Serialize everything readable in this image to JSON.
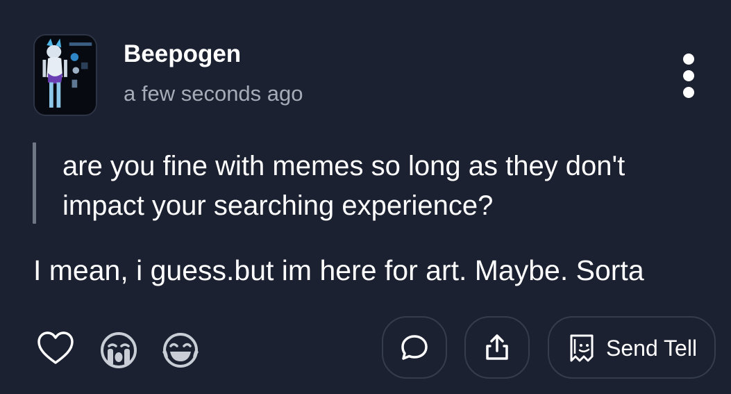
{
  "post": {
    "author": "Beepogen",
    "timestamp": "a few seconds ago",
    "avatar_icon": "character-art-avatar",
    "menu_icon": "vertical-ellipsis-icon",
    "quote": "are you fine with memes so long as they don't impact your searching experience?",
    "reply": "I mean, i guess.but im here for art. Maybe. Sorta"
  },
  "actions": {
    "like_icon": "heart-outline-icon",
    "cry_icon": "crying-face-icon",
    "laugh_icon": "laughing-face-icon",
    "comment_icon": "speech-bubble-icon",
    "share_icon": "share-upload-icon",
    "send_tell_icon": "paper-note-icon",
    "send_tell_label": "Send Tell"
  },
  "colors": {
    "background": "#1b2130",
    "text_primary": "#ffffff",
    "text_secondary": "#a6acb8",
    "quote_bar": "#6f7684",
    "pill_border": "#353d4d"
  }
}
